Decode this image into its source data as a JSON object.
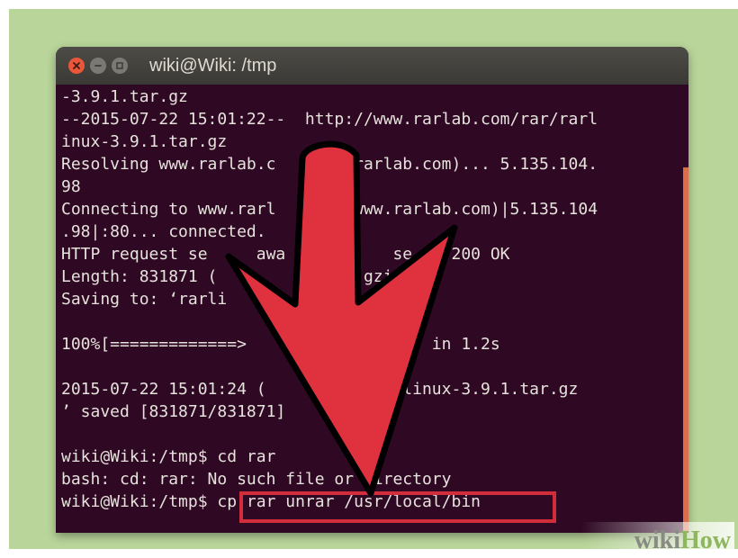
{
  "window": {
    "title": "wiki@Wiki: /tmp"
  },
  "terminal": {
    "lines": [
      "-3.9.1.tar.gz",
      "--2015-07-22 15:01:22--  http://www.rarlab.com/rar/rarl",
      "inux-3.9.1.tar.gz",
      "Resolving www.rarlab.c     ww.rarlab.com)... 5.135.104.",
      "98",
      "Connecting to www.rarl     m (www.rarlab.com)|5.135.104",
      ".98|:80... connected.",
      "HTTP request se     awa      r    se... 200 OK",
      "Length: 831871 (            /x-gzip]",
      "Saving to: ‘rarli",
      "",
      "100%[=============>         656KB/s   in 1.2s",
      "",
      "2015-07-22 15:01:24 (        - ‘rarlinux-3.9.1.tar.gz",
      "’ saved [831871/831871]",
      "",
      "wiki@Wiki:/tmp$ cd rar",
      "bash: cd: rar: No such file or directory"
    ],
    "prompt": "wiki@Wiki:/tmp$ ",
    "command": "cp rar unrar /usr/local/bin"
  },
  "watermark": {
    "part1": "wiki",
    "part2": "How"
  },
  "colors": {
    "background": "#b9d59a",
    "terminal_bg": "#2f0923",
    "text": "#e6e2dc",
    "arrow": "#e0313f",
    "highlight": "#d12d3b"
  }
}
